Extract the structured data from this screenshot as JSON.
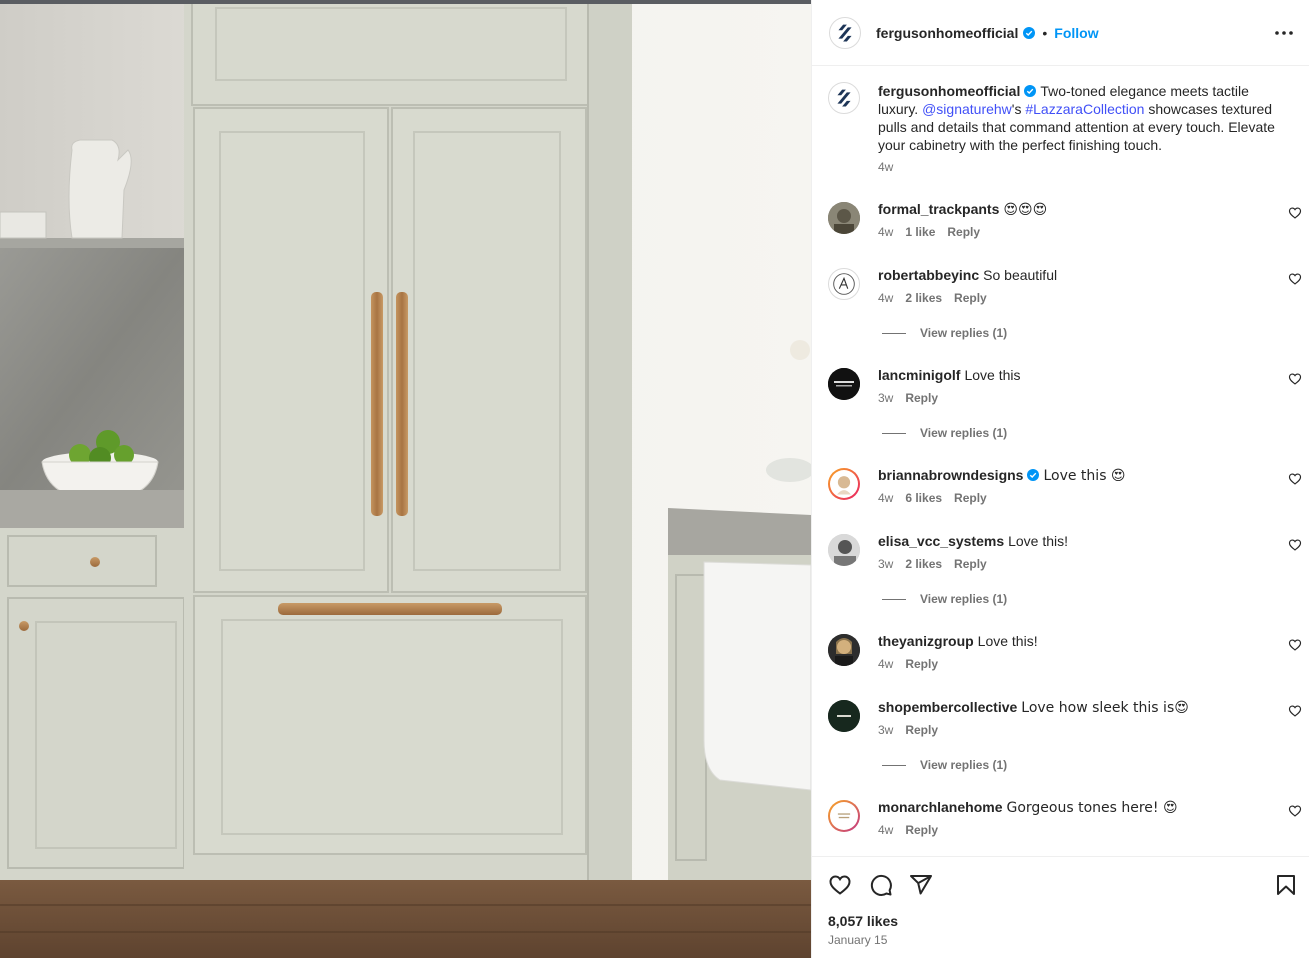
{
  "post": {
    "username": "fergusonhomeofficial",
    "follow_label": "Follow",
    "separator": "•",
    "caption_pre": "Two-toned elegance meets tactile luxury. ",
    "caption_mention": "@signaturehw",
    "caption_mid": "'s ",
    "caption_hashtag": "#LazzaraCollection",
    "caption_post": " showcases textured pulls and details that command attention at every touch. Elevate your cabinetry with the perfect finishing touch.",
    "caption_time": "4w"
  },
  "comments": [
    {
      "user": "formal_trackpants",
      "text": "😍😍😍",
      "time": "4w",
      "likes": "1 like",
      "reply": "Reply"
    },
    {
      "user": "robertabbeyinc",
      "text": "So beautiful",
      "time": "4w",
      "likes": "2 likes",
      "reply": "Reply",
      "view_replies": "View replies (1)"
    },
    {
      "user": "lancminigolf",
      "text": "Love this",
      "time": "3w",
      "reply": "Reply",
      "view_replies": "View replies (1)"
    },
    {
      "user": "briannabrowndesigns",
      "text": "Love this 😍",
      "time": "4w",
      "likes": "6 likes",
      "reply": "Reply"
    },
    {
      "user": "elisa_vcc_systems",
      "text": "Love this!",
      "time": "3w",
      "likes": "2 likes",
      "reply": "Reply",
      "view_replies": "View replies (1)"
    },
    {
      "user": "theyanizgroup",
      "text": "Love this!",
      "time": "4w",
      "reply": "Reply"
    },
    {
      "user": "shopembercollective",
      "text": "Love how sleek this is😍",
      "time": "3w",
      "reply": "Reply",
      "view_replies": "View replies (1)"
    },
    {
      "user": "monarchlanehome",
      "text": "Gorgeous tones here! 😍",
      "time": "4w",
      "reply": "Reply"
    }
  ],
  "footer": {
    "likes": "8,057 likes",
    "date": "January 15"
  },
  "icons": {
    "header_more": "more-options-icon",
    "like": "heart-icon",
    "comment": "comment-icon",
    "share": "share-icon",
    "save": "bookmark-icon",
    "verified": "verified-badge-icon"
  },
  "colors": {
    "link": "#4150f7",
    "follow": "#0095f6",
    "verified": "#0095f6",
    "cabinet": "#d4d6cb",
    "brass": "#b07e4c"
  }
}
